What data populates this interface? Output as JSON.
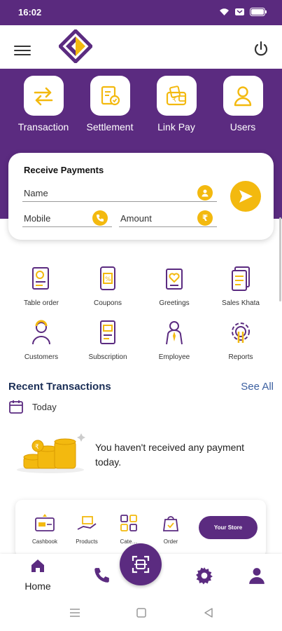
{
  "status_bar": {
    "time": "16:02"
  },
  "colors": {
    "brand_purple": "#5b2b80",
    "accent_yellow": "#f3b90f",
    "link_blue": "#3b5fa0"
  },
  "quick_actions": [
    {
      "label": "Transaction",
      "icon": "swap-arrows-icon"
    },
    {
      "label": "Settlement",
      "icon": "settlement-icon"
    },
    {
      "label": "Link Pay",
      "icon": "wallet-icon"
    },
    {
      "label": "Users",
      "icon": "user-icon"
    }
  ],
  "receive_payments": {
    "title": "Receive Payments",
    "name_placeholder": "Name",
    "mobile_placeholder": "Mobile",
    "amount_placeholder": "Amount"
  },
  "features": [
    {
      "label": "Table order",
      "icon": "table-order-icon"
    },
    {
      "label": "Coupons",
      "icon": "coupon-icon"
    },
    {
      "label": "Greetings",
      "icon": "greeting-card-icon"
    },
    {
      "label": "Sales Khata",
      "icon": "ledger-icon"
    },
    {
      "label": "Customers",
      "icon": "customer-icon"
    },
    {
      "label": "Subscription",
      "icon": "subscription-icon"
    },
    {
      "label": "Employee",
      "icon": "employee-icon"
    },
    {
      "label": "Reports",
      "icon": "reports-gear-icon"
    }
  ],
  "recent": {
    "title": "Recent Transactions",
    "see_all": "See All",
    "period": "Today",
    "empty_message": "You haven't received any payment today."
  },
  "store_card": {
    "items": [
      {
        "label": "Cashbook",
        "icon": "cashbook-icon"
      },
      {
        "label": "Products",
        "icon": "products-icon"
      },
      {
        "label": "Cate…",
        "icon": "categories-icon"
      },
      {
        "label": "Order",
        "icon": "order-bag-icon"
      }
    ],
    "store_button": "Your Store"
  },
  "bottom_nav": {
    "home_label": "Home"
  }
}
